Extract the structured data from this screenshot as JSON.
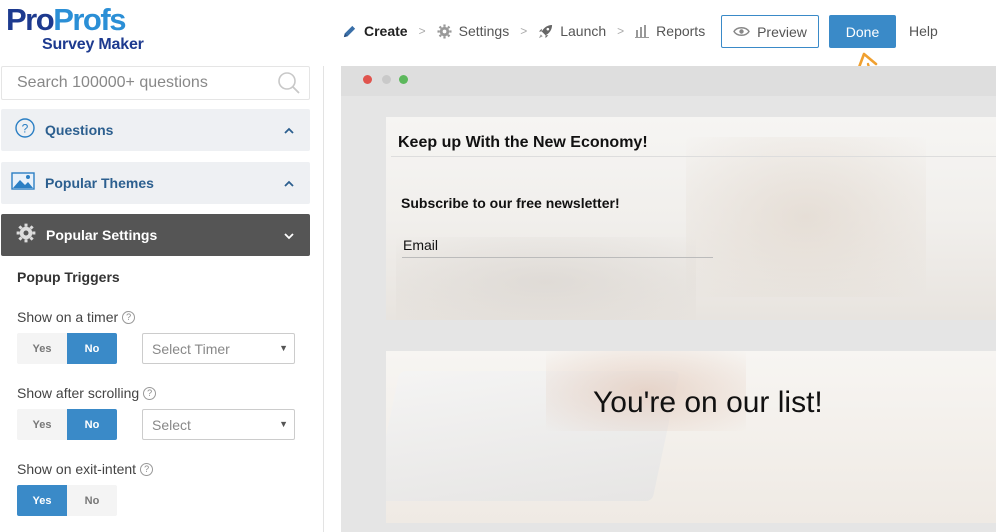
{
  "logo": {
    "pro1": "Pro",
    "pro2": "Profs",
    "sub": "Survey Maker"
  },
  "nav": {
    "create": "Create",
    "settings": "Settings",
    "launch": "Launch",
    "reports": "Reports",
    "separator": ">",
    "preview": "Preview",
    "done": "Done",
    "help": "Help"
  },
  "sidebar": {
    "search_placeholder": "Search 100000+ questions",
    "panels": {
      "questions": "Questions",
      "themes": "Popular Themes",
      "settings": "Popular Settings"
    },
    "section_title": "Popup Triggers",
    "rows": {
      "timer": {
        "label": "Show on a timer",
        "yes": "Yes",
        "no": "No",
        "selected": "No",
        "select": "Select Timer"
      },
      "scrolling": {
        "label": "Show after scrolling",
        "yes": "Yes",
        "no": "No",
        "selected": "No",
        "select": "Select"
      },
      "exit": {
        "label": "Show on exit-intent",
        "yes": "Yes",
        "no": "No",
        "selected": "Yes"
      }
    },
    "help_glyph": "?"
  },
  "preview": {
    "popup1": {
      "title": "Keep up With the New Economy!",
      "subtitle": "Subscribe to our free newsletter!",
      "email_placeholder": "Email"
    },
    "popup2": {
      "message": "You're on our list!"
    }
  },
  "colors": {
    "accent": "#3a8ac8",
    "brand_dark": "#1d3a8f",
    "annotation": "#f0a030"
  },
  "icons": {
    "create": "pencil-icon",
    "settings": "gear-icon",
    "launch": "rocket-icon",
    "reports": "bar-chart-icon",
    "preview": "eye-icon",
    "search": "search-icon",
    "questions": "question-circle-icon",
    "themes": "image-icon",
    "settings_panel": "gear-icon"
  }
}
